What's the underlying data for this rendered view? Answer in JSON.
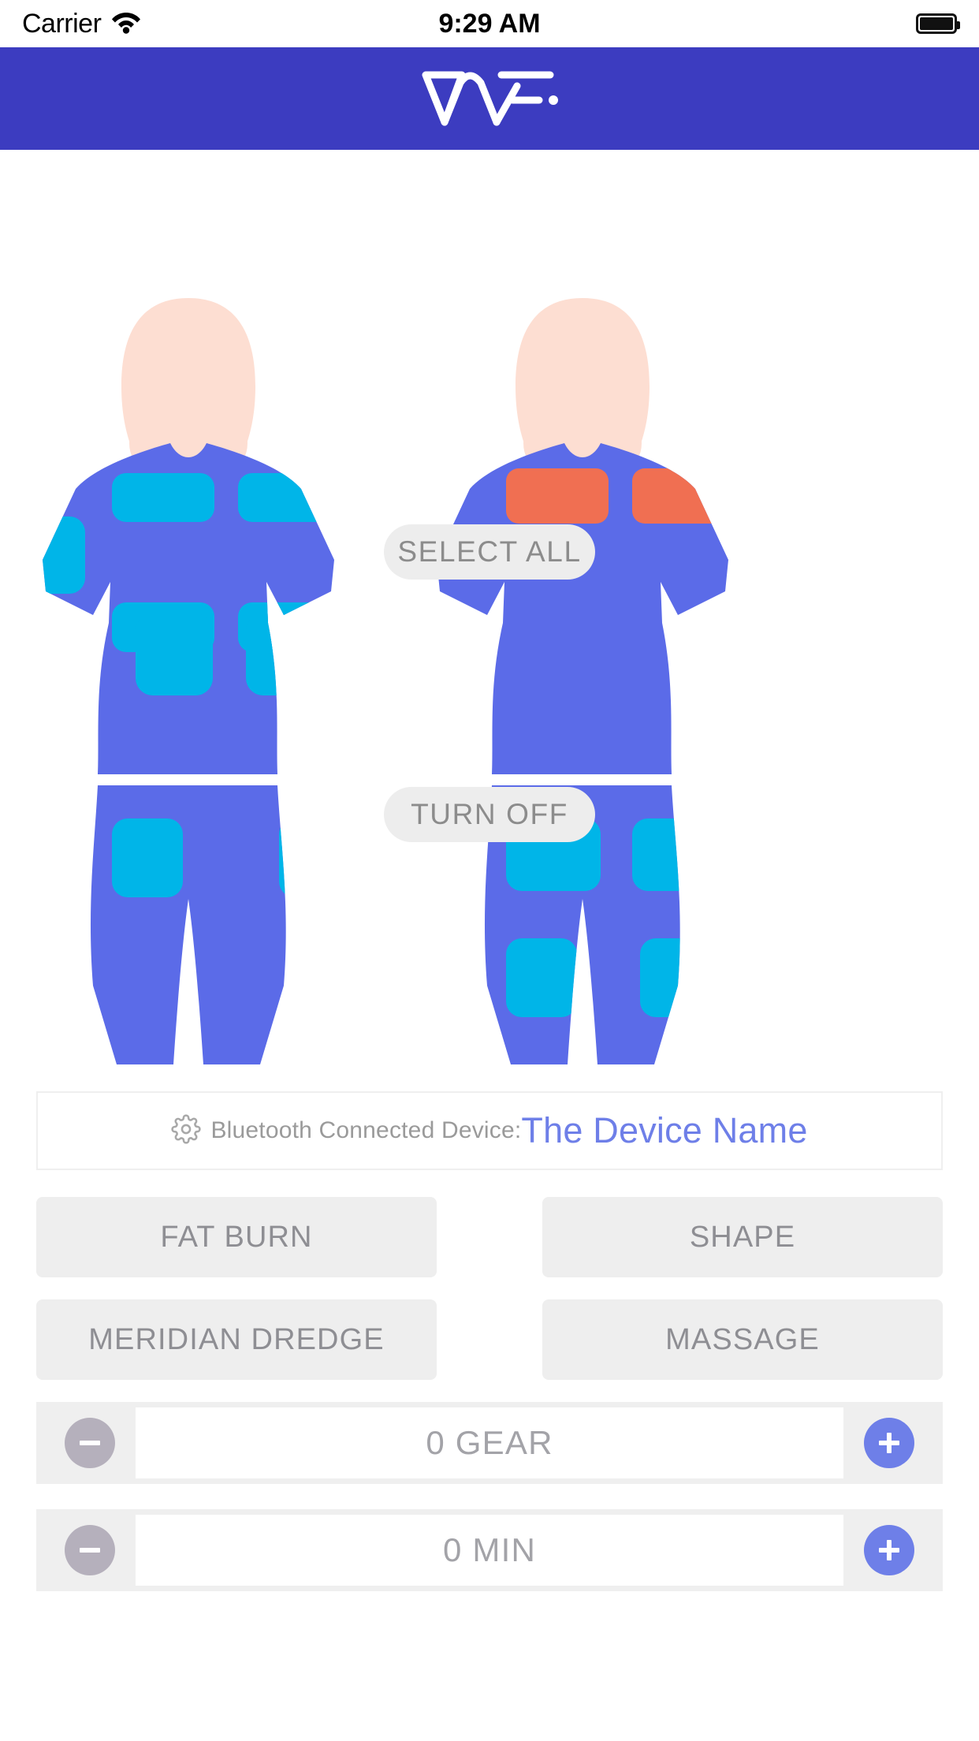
{
  "status_bar": {
    "carrier": "Carrier",
    "wifi_icon": "wifi-icon",
    "time": "9:29 AM",
    "battery_icon": "battery-full-icon"
  },
  "header": {
    "brand": "WF.",
    "logo_icon": "wf-logo-icon",
    "background_color": "#3C3CC0"
  },
  "body_map": {
    "front_label": "front-body-figure",
    "back_label": "back-body-figure",
    "select_all_label": "SELECT ALL",
    "turn_off_label": "TURN OFF",
    "colors": {
      "skin": "#FDDED2",
      "suit": "#5B6BE8",
      "pad_active": "#00B5E8",
      "pad_alert": "#F06F52"
    },
    "front_pads": [
      {
        "name": "chest-left",
        "state": "active"
      },
      {
        "name": "chest-right",
        "state": "active"
      },
      {
        "name": "arm-left",
        "state": "active"
      },
      {
        "name": "arm-right",
        "state": "active"
      },
      {
        "name": "abdomen-left",
        "state": "active"
      },
      {
        "name": "abdomen-right",
        "state": "active"
      },
      {
        "name": "thigh-left",
        "state": "active"
      },
      {
        "name": "thigh-right",
        "state": "active"
      }
    ],
    "back_pads": [
      {
        "name": "upper-back-left",
        "state": "alert"
      },
      {
        "name": "upper-back-right",
        "state": "alert"
      },
      {
        "name": "glute-left",
        "state": "active"
      },
      {
        "name": "glute-right",
        "state": "active"
      },
      {
        "name": "hamstring-left",
        "state": "active"
      },
      {
        "name": "hamstring-right",
        "state": "active"
      }
    ]
  },
  "bluetooth": {
    "gear_icon": "gear-icon",
    "label": "Bluetooth Connected Device:",
    "device_name": "The Device Name",
    "device_name_color": "#6E7FE8"
  },
  "modes": [
    {
      "label": "FAT BURN"
    },
    {
      "label": "SHAPE"
    },
    {
      "label": "MERIDIAN DREDGE"
    },
    {
      "label": "MASSAGE"
    }
  ],
  "steppers": [
    {
      "name": "gear",
      "value": "0 GEAR",
      "decrement_label": "minus-icon",
      "increment_label": "plus-icon"
    },
    {
      "name": "time",
      "value": "0 MIN",
      "decrement_label": "minus-icon",
      "increment_label": "plus-icon"
    }
  ]
}
